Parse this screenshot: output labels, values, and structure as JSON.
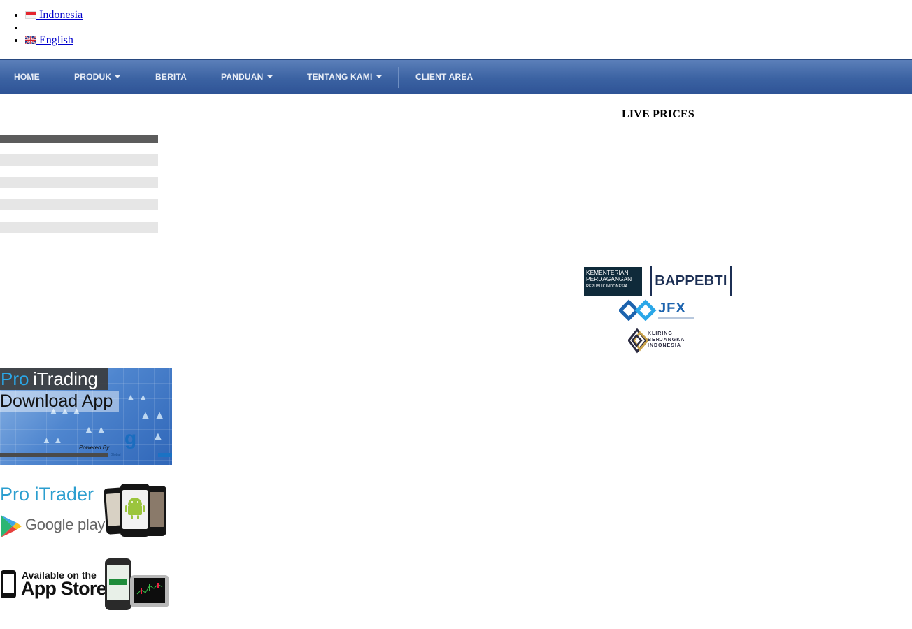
{
  "languages": [
    {
      "label": " Indonesia",
      "flag": "flag-indonesia-icon"
    },
    {
      "label": "",
      "flag": ""
    },
    {
      "label": " English",
      "flag": "flag-uk-icon"
    }
  ],
  "nav": {
    "items": [
      {
        "label": "HOME",
        "dropdown": false
      },
      {
        "label": "PRODUK",
        "dropdown": true
      },
      {
        "label": "BERITA",
        "dropdown": false
      },
      {
        "label": "PANDUAN",
        "dropdown": true
      },
      {
        "label": "TENTANG KAMI",
        "dropdown": true
      },
      {
        "label": "CLIENT AREA",
        "dropdown": false
      }
    ]
  },
  "live_prices": {
    "title": "LIVE PRICES"
  },
  "regulators": {
    "kemendag": {
      "line1": "KEMENTERIAN",
      "line2": "PERDAGANGAN",
      "line3": "REPUBLIK INDONESIA"
    },
    "bappebti": "BAPPEBTI",
    "jfx": "JFX",
    "kbi": {
      "line1": "KLIRING",
      "line2": "BERJANGKA",
      "line3": "INDONESIA"
    }
  },
  "banners": {
    "itrading": {
      "pro": "Pro",
      "name": "iTrading",
      "cta": "Download App",
      "powered": "Powered By",
      "provider": "Global"
    },
    "itrader": {
      "title": "Pro iTrader",
      "store": "Google play"
    },
    "appstore": {
      "line1": "Available on the",
      "line2": "App Store"
    }
  },
  "colors": {
    "nav_top": "#5b7fb9",
    "nav_bottom": "#2e5396",
    "link": "#0000cc"
  }
}
